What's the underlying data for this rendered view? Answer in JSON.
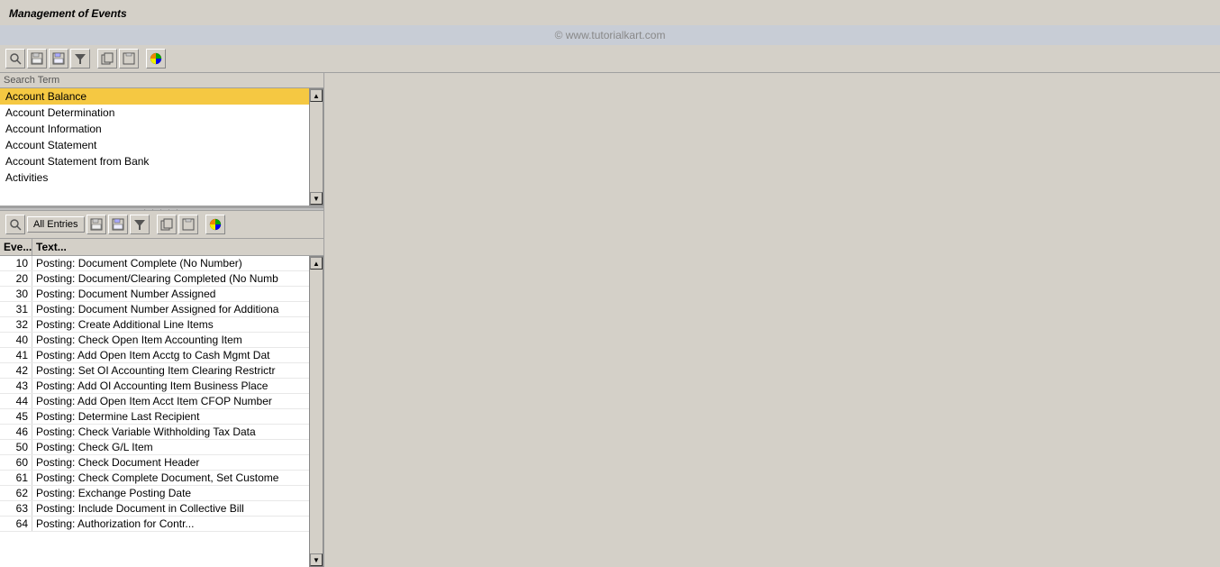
{
  "title": "Management of Events",
  "watermark": "© www.tutorialkart.com",
  "toolbar1": {
    "buttons": [
      "search",
      "save",
      "save-local",
      "filter",
      "copy",
      "paste",
      "pie-chart"
    ]
  },
  "search_panel": {
    "label": "Search Term",
    "items": [
      {
        "text": "Account Balance",
        "selected": true
      },
      {
        "text": "Account Determination",
        "selected": false
      },
      {
        "text": "Account Information",
        "selected": false
      },
      {
        "text": "Account Statement",
        "selected": false
      },
      {
        "text": "Account Statement from Bank",
        "selected": false
      },
      {
        "text": "Activities",
        "selected": false
      }
    ]
  },
  "events_panel": {
    "all_entries_label": "All Entries",
    "columns": {
      "eve": "Eve...",
      "text": "Text..."
    },
    "rows": [
      {
        "eve": "10",
        "text": "Posting: Document Complete (No Number)"
      },
      {
        "eve": "20",
        "text": "Posting: Document/Clearing Completed (No Numb"
      },
      {
        "eve": "30",
        "text": "Posting: Document Number Assigned"
      },
      {
        "eve": "31",
        "text": "Posting: Document Number Assigned for Additiona"
      },
      {
        "eve": "32",
        "text": "Posting: Create Additional Line Items"
      },
      {
        "eve": "40",
        "text": "Posting: Check Open Item Accounting Item"
      },
      {
        "eve": "41",
        "text": "Posting: Add Open Item Acctg to Cash Mgmt Dat"
      },
      {
        "eve": "42",
        "text": "Posting: Set OI Accounting Item Clearing Restrictr"
      },
      {
        "eve": "43",
        "text": "Posting: Add OI Accounting Item Business Place"
      },
      {
        "eve": "44",
        "text": "Posting: Add Open Item Acct Item CFOP Number"
      },
      {
        "eve": "45",
        "text": "Posting: Determine Last Recipient"
      },
      {
        "eve": "46",
        "text": "Posting: Check Variable Withholding Tax Data"
      },
      {
        "eve": "50",
        "text": "Posting: Check G/L Item"
      },
      {
        "eve": "60",
        "text": "Posting: Check Document Header"
      },
      {
        "eve": "61",
        "text": "Posting: Check Complete Document, Set Custome"
      },
      {
        "eve": "62",
        "text": "Posting: Exchange Posting Date"
      },
      {
        "eve": "63",
        "text": "Posting: Include Document in Collective Bill"
      },
      {
        "eve": "64",
        "text": "Posting: Authorization for Contr..."
      }
    ]
  }
}
